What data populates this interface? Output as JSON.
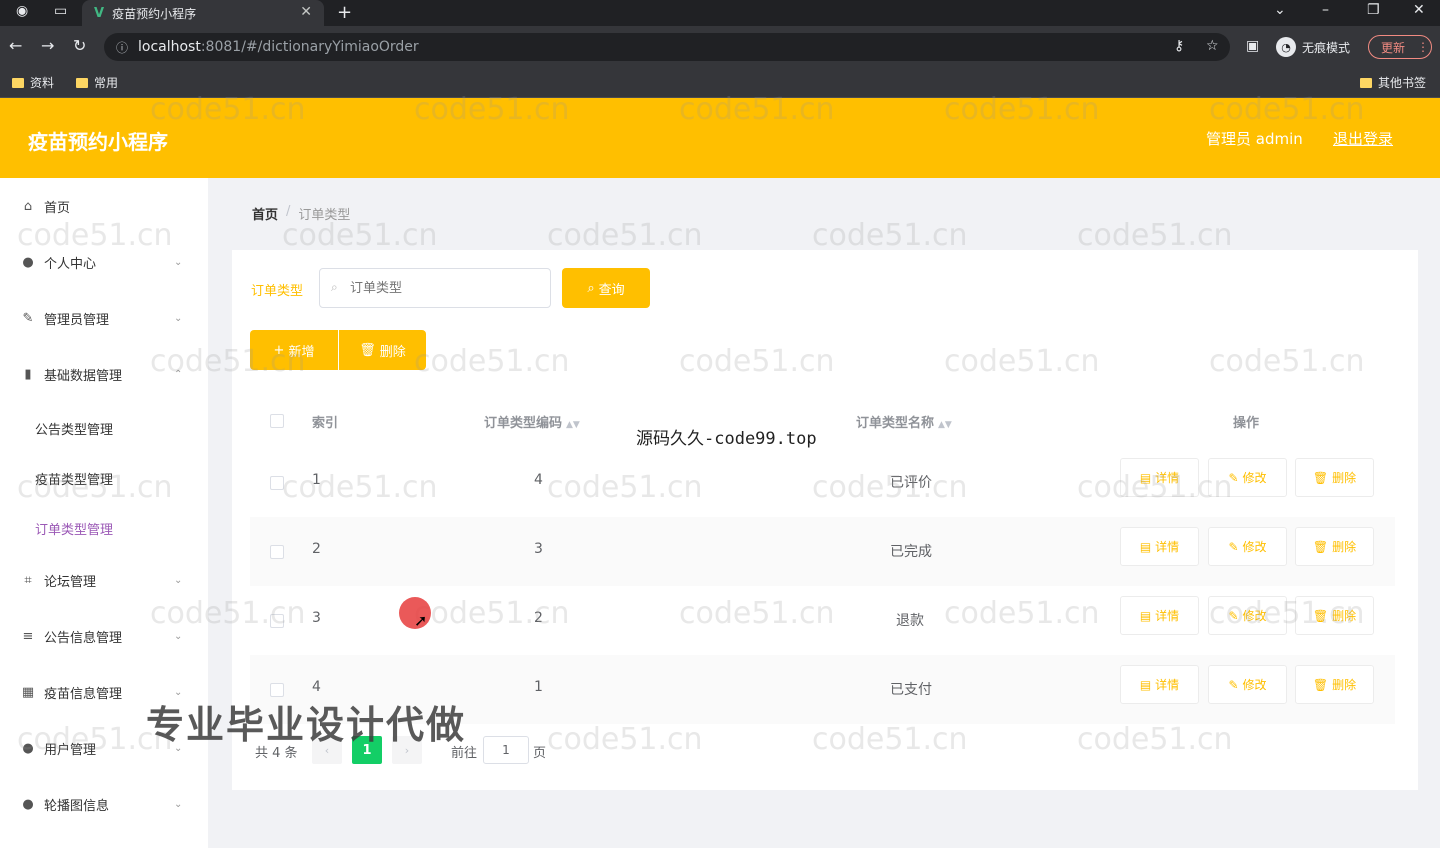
{
  "browser": {
    "tab_title": "疫苗预约小程序",
    "url_host": "localhost",
    "url_path": ":8081/#/dictionaryYimiaoOrder",
    "incognito_label": "无痕模式",
    "update_label": "更新",
    "bookmarks": [
      "资料",
      "常用"
    ],
    "other_bookmarks": "其他书签"
  },
  "header": {
    "title": "疫苗预约小程序",
    "admin_label": "管理员 admin",
    "logout_label": "退出登录"
  },
  "sidebar": {
    "items": [
      {
        "label": "首页",
        "icon": "home-icon"
      },
      {
        "label": "个人中心",
        "icon": "user-icon"
      },
      {
        "label": "管理员管理",
        "icon": "edit-icon"
      },
      {
        "label": "基础数据管理",
        "icon": "chart-icon"
      },
      {
        "label": "论坛管理",
        "icon": "crop-icon"
      },
      {
        "label": "公告信息管理",
        "icon": "list-icon"
      },
      {
        "label": "疫苗信息管理",
        "icon": "grid-icon"
      },
      {
        "label": "用户管理",
        "icon": "user-icon"
      },
      {
        "label": "轮播图信息",
        "icon": "user-icon"
      }
    ],
    "sub_items": [
      "公告类型管理",
      "疫苗类型管理",
      "订单类型管理"
    ]
  },
  "breadcrumb": {
    "home": "首页",
    "sep": "/",
    "current": "订单类型"
  },
  "search": {
    "label": "订单类型",
    "placeholder": "订单类型",
    "query_label": "查询"
  },
  "toolbar": {
    "add_label": "新增",
    "delete_label": "删除"
  },
  "table": {
    "columns": [
      "索引",
      "订单类型编码",
      "订单类型名称",
      "操作"
    ],
    "rows": [
      {
        "index": "1",
        "code": "4",
        "name": "已评价"
      },
      {
        "index": "2",
        "code": "3",
        "name": "已完成"
      },
      {
        "index": "3",
        "code": "2",
        "name": "退款"
      },
      {
        "index": "4",
        "code": "1",
        "name": "已支付"
      }
    ],
    "actions": {
      "detail": "详情",
      "edit": "修改",
      "delete": "删除"
    }
  },
  "pagination": {
    "total_label": "共 4 条",
    "current_page": "1",
    "goto_label": "前往",
    "goto_value": "1",
    "goto_suffix": "页"
  },
  "overlay": {
    "watermark": "code51.cn",
    "center_text": "源码久久-code99.top",
    "promo_text": "专业毕业设计代做"
  },
  "colors": {
    "accent": "#ffbf00",
    "active_menu": "#9b59b6",
    "page_active": "#13ce66"
  }
}
